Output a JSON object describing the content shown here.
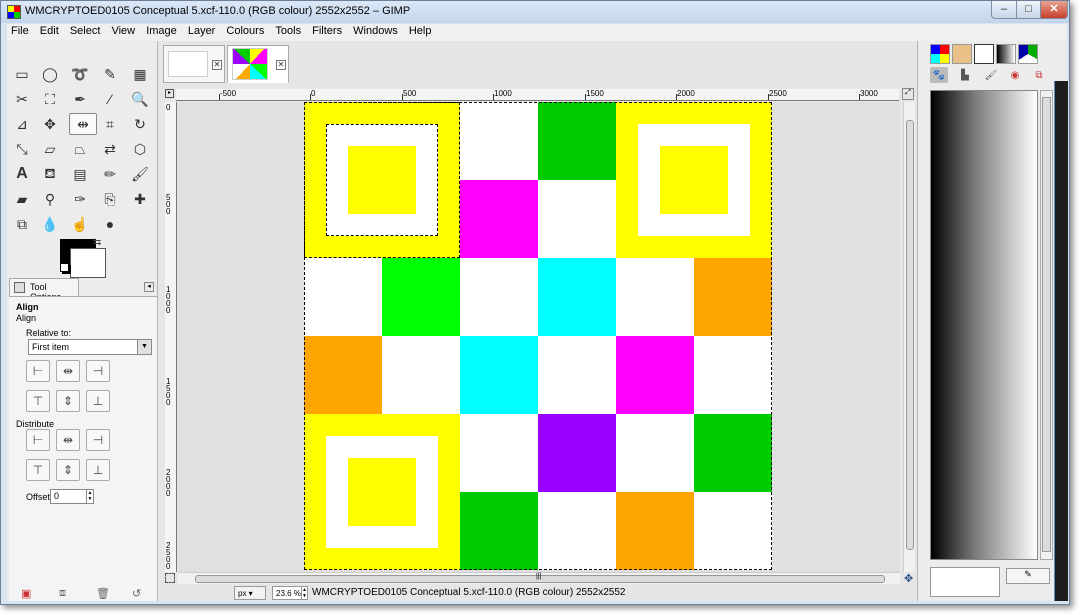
{
  "window": {
    "title": "WMCRYPTOED0105 Conceptual 5.xcf-110.0 (RGB colour) 2552x2552 – GIMP",
    "min_glyph": "–",
    "max_glyph": "□",
    "close_glyph": "✕"
  },
  "menubar": [
    "File",
    "Edit",
    "Select",
    "View",
    "Image",
    "Layer",
    "Colours",
    "Tools",
    "Filters",
    "Windows",
    "Help"
  ],
  "tool_options": {
    "tab_label": "Tool Options",
    "section_title": "Align",
    "tool_name": "Align",
    "relative_label": "Relative to:",
    "relative_value": "First item",
    "distribute_label": "Distribute",
    "offset_label": "Offset:",
    "offset_value": "0"
  },
  "ruler": {
    "h_labels": [
      "-500",
      "0",
      "500",
      "1000",
      "1500",
      "2000",
      "2500",
      "3000"
    ],
    "v_labels": [
      "0",
      "500",
      "1000",
      "1500",
      "2000",
      "2500"
    ]
  },
  "status": {
    "unit": "px",
    "zoom": "23.6 %",
    "text": "WMCRYPTOED0105 Conceptual 5.xcf-110.0 (RGB colour) 2552x2552"
  },
  "colors": {
    "yellow": "#ffff00",
    "white": "#ffffff",
    "green": "#00cc00",
    "bright_green": "#00ff00",
    "magenta": "#ff00ff",
    "cyan": "#00ffff",
    "orange": "#ffa500",
    "purple": "#9900ff"
  },
  "canvas_grid": [
    [
      "Y",
      "Y",
      "W",
      "G",
      "Y",
      "Y"
    ],
    [
      "Y",
      "Y",
      "M",
      "W",
      "Y",
      "Y"
    ],
    [
      "W",
      "L",
      "W",
      "C",
      "W",
      "O"
    ],
    [
      "O",
      "W",
      "C",
      "W",
      "M",
      "W"
    ],
    [
      "Y",
      "Y",
      "W",
      "P",
      "W",
      "G"
    ],
    [
      "Y",
      "Y",
      "G",
      "W",
      "O",
      "W"
    ]
  ]
}
